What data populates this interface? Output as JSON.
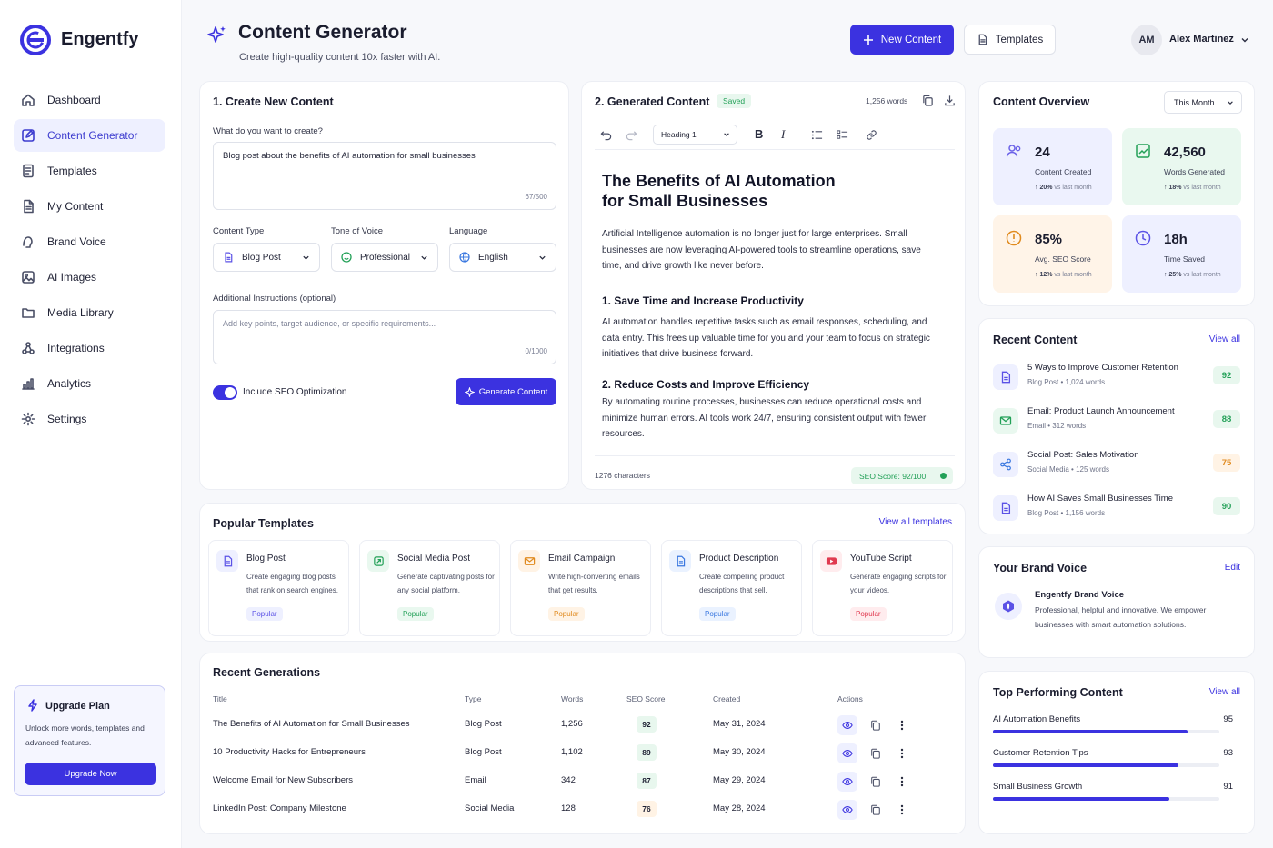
{
  "brand": {
    "name": "Engentfy"
  },
  "sidebar": {
    "items": [
      {
        "label": "Dashboard",
        "icon": "home-icon"
      },
      {
        "label": "Content Generator",
        "icon": "edit-icon",
        "active": true
      },
      {
        "label": "Templates",
        "icon": "template-icon"
      },
      {
        "label": "My Content",
        "icon": "document-icon"
      },
      {
        "label": "Brand Voice",
        "icon": "voice-icon"
      },
      {
        "label": "AI Images",
        "icon": "image-icon"
      },
      {
        "label": "Media Library",
        "icon": "folder-icon"
      },
      {
        "label": "Integrations",
        "icon": "integrations-icon"
      },
      {
        "label": "Analytics",
        "icon": "analytics-icon"
      },
      {
        "label": "Settings",
        "icon": "gear-icon"
      }
    ],
    "upgrade": {
      "title": "Upgrade Plan",
      "desc": "Unlock more words, templates and advanced features.",
      "button": "Upgrade Now"
    }
  },
  "header": {
    "title": "Content Generator",
    "subtitle": "Create high-quality content 10x faster with AI.",
    "new_content": "New Content",
    "templates": "Templates",
    "user": {
      "initials": "AM",
      "name": "Alex Martinez"
    }
  },
  "create": {
    "title": "1. Create New Content",
    "prompt_label": "What do you want to create?",
    "prompt_value": "Blog post about the benefits of AI automation for small businesses",
    "prompt_count": "67/500",
    "content_type_label": "Content Type",
    "content_type_value": "Blog Post",
    "tone_label": "Tone of Voice",
    "tone_value": "Professional",
    "language_label": "Language",
    "language_value": "English",
    "additional_label": "Additional Instructions (optional)",
    "additional_placeholder": "Add key points, target audience, or specific requirements...",
    "additional_count": "0/1000",
    "seo_label": "Include SEO Optimization",
    "seo_enabled": true,
    "generate_button": "Generate Content"
  },
  "generated": {
    "title": "2. Generated Content",
    "status": "Saved",
    "word_count": "1,256 words",
    "heading_select": "Heading 1",
    "article_title": "The Benefits of AI Automation for Small Businesses",
    "intro": "Artificial Intelligence automation is no longer just for large enterprises. Small businesses are now leveraging AI-powered tools to streamline operations, save time, and drive growth like never before.",
    "h2_1": "1. Save Time and Increase Productivity",
    "p1": "AI automation handles repetitive tasks such as email responses, scheduling, and data entry. This frees up valuable time for you and your team to focus on strategic initiatives that drive business forward.",
    "h2_2": "2. Reduce Costs and Improve Efficiency",
    "p2": "By automating routine processes, businesses can reduce operational costs and minimize human errors. AI tools work 24/7, ensuring consistent output with fewer resources.",
    "char_count": "1276 characters",
    "seo_score": "SEO Score: 92/100"
  },
  "overview": {
    "title": "Content Overview",
    "period": "This Month",
    "stats": [
      {
        "value": "24",
        "label": "Content Created",
        "change": "20%",
        "suffix": "vs last month",
        "color": "#eef0ff",
        "icon": "users-icon"
      },
      {
        "value": "42,560",
        "label": "Words Generated",
        "change": "18%",
        "suffix": "vs last month",
        "color": "#e9f8ef",
        "icon": "chart-icon"
      },
      {
        "value": "85%",
        "label": "Avg. SEO Score",
        "change": "12%",
        "suffix": "vs last month",
        "color": "#fff4e8",
        "icon": "seo-icon"
      },
      {
        "value": "18h",
        "label": "Time Saved",
        "change": "25%",
        "suffix": "vs last month",
        "color": "#eef0ff",
        "icon": "clock-icon"
      }
    ]
  },
  "recent_content": {
    "title": "Recent Content",
    "view_all": "View all",
    "items": [
      {
        "title": "5 Ways to Improve Customer Retention",
        "type": "Blog Post",
        "words": "1,024 words",
        "score": "92",
        "icon": "document-icon"
      },
      {
        "title": "Email: Product Launch Announcement",
        "type": "Email",
        "words": "312 words",
        "score": "88",
        "icon": "mail-icon"
      },
      {
        "title": "Social Post: Sales Motivation",
        "type": "Social Media",
        "words": "125 words",
        "score": "75",
        "icon": "share-icon"
      },
      {
        "title": "How AI Saves Small Businesses Time",
        "type": "Blog Post",
        "words": "1,156 words",
        "score": "90",
        "icon": "document-icon"
      }
    ]
  },
  "brand_voice": {
    "title": "Your Brand Voice",
    "edit": "Edit",
    "name": "Engentfy Brand Voice",
    "desc": "Professional, helpful and innovative. We empower businesses with smart automation solutions."
  },
  "top_performing": {
    "title": "Top Performing Content",
    "view_all": "View all",
    "items": [
      {
        "label": "AI Automation Benefits",
        "value": "95",
        "pct": 0.86
      },
      {
        "label": "Customer Retention Tips",
        "value": "93",
        "pct": 0.82
      },
      {
        "label": "Small Business Growth",
        "value": "91",
        "pct": 0.78
      }
    ]
  },
  "popular_templates": {
    "title": "Popular Templates",
    "view_all": "View all templates",
    "items": [
      {
        "name": "Blog Post",
        "desc": "Create engaging blog posts that rank on search engines.",
        "badge": "Popular",
        "color": "#eef0ff",
        "accent": "#5b52e6",
        "icon": "document-icon"
      },
      {
        "name": "Social Media Post",
        "desc": "Generate captivating posts for any social platform.",
        "badge": "Popular",
        "color": "#e9f8ef",
        "accent": "#22a057",
        "icon": "share-icon"
      },
      {
        "name": "Email Campaign",
        "desc": "Write high-converting emails that get results.",
        "badge": "Popular",
        "color": "#fff3e5",
        "accent": "#e08a1e",
        "icon": "mail-icon"
      },
      {
        "name": "Product Description",
        "desc": "Create compelling product descriptions that sell.",
        "badge": "Popular",
        "color": "#eaf2ff",
        "accent": "#3a78e0",
        "icon": "document-icon"
      },
      {
        "name": "YouTube Script",
        "desc": "Generate engaging scripts for your videos.",
        "badge": "Popular",
        "color": "#ffecee",
        "accent": "#e0394f",
        "icon": "play-icon"
      }
    ]
  },
  "recent_generations": {
    "title": "Recent Generations",
    "columns": [
      "Title",
      "Type",
      "Words",
      "SEO Score",
      "Created",
      "Actions"
    ],
    "rows": [
      {
        "title": "The Benefits of AI Automation for Small Businesses",
        "type": "Blog Post",
        "words": "1,256",
        "seo": "92",
        "created": "May 31, 2024"
      },
      {
        "title": "10 Productivity Hacks for Entrepreneurs",
        "type": "Blog Post",
        "words": "1,102",
        "seo": "89",
        "created": "May 30, 2024"
      },
      {
        "title": "Welcome Email for New Subscribers",
        "type": "Email",
        "words": "342",
        "seo": "87",
        "created": "May 29, 2024"
      },
      {
        "title": "LinkedIn Post: Company Milestone",
        "type": "Social Media",
        "words": "128",
        "seo": "76",
        "created": "May 28, 2024"
      }
    ]
  }
}
